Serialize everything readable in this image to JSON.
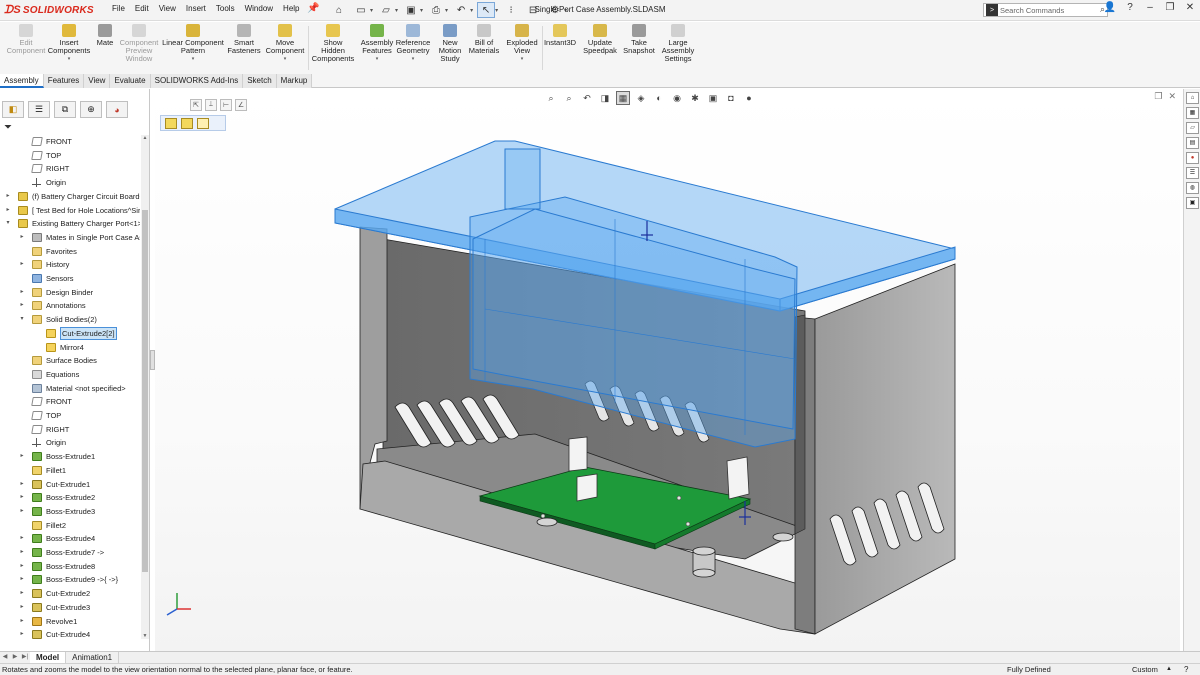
{
  "app": {
    "brand": "SOLIDWORKS",
    "doc_title": "Single Port Case Assembly.SLDASM",
    "menus": [
      "File",
      "Edit",
      "View",
      "Insert",
      "Tools",
      "Window",
      "Help"
    ],
    "search_placeholder": "Search Commands"
  },
  "commands": [
    {
      "label": "Edit Component",
      "disabled": true
    },
    {
      "label": "Insert Components",
      "disabled": false
    },
    {
      "label": "Mate",
      "disabled": false
    },
    {
      "label": "Component Preview Window",
      "disabled": true
    },
    {
      "label": "Linear Component Pattern",
      "disabled": false
    },
    {
      "label": "Smart Fasteners",
      "disabled": false
    },
    {
      "label": "Move Component",
      "disabled": false
    },
    {
      "label": "Show Hidden Components",
      "disabled": false
    },
    {
      "label": "Assembly Features",
      "disabled": false
    },
    {
      "label": "Reference Geometry",
      "disabled": false
    },
    {
      "label": "New Motion Study",
      "disabled": false
    },
    {
      "label": "Bill of Materials",
      "disabled": false
    },
    {
      "label": "Exploded View",
      "disabled": false
    },
    {
      "label": "Instant3D",
      "disabled": false
    },
    {
      "label": "Update Speedpak",
      "disabled": false
    },
    {
      "label": "Take Snapshot",
      "disabled": false
    },
    {
      "label": "Large Assembly Settings",
      "disabled": false
    }
  ],
  "tabs": [
    "Assembly",
    "Features",
    "View",
    "Evaluate",
    "SOLIDWORKS Add-Ins",
    "Sketch",
    "Markup"
  ],
  "tree": [
    {
      "label": "FRONT",
      "icon": "plane-icon",
      "indent": 1
    },
    {
      "label": "TOP",
      "icon": "plane-icon",
      "indent": 1
    },
    {
      "label": "RIGHT",
      "icon": "plane-icon",
      "indent": 1
    },
    {
      "label": "Origin",
      "icon": "origin-icon",
      "indent": 1
    },
    {
      "label": "(f) Battery Charger Circuit Board<",
      "icon": "part-icon",
      "indent": 0,
      "toggle": "▸"
    },
    {
      "label": "[ Test Bed for Hole Locations^Sir",
      "icon": "part-icon",
      "indent": 0,
      "toggle": "▸"
    },
    {
      "label": "Existing Battery Charger Port<1>",
      "icon": "part-icon",
      "indent": 0,
      "toggle": "▾"
    },
    {
      "label": "Mates in Single Port Case As",
      "icon": "mate-icon",
      "indent": 1,
      "toggle": "▸"
    },
    {
      "label": "Favorites",
      "icon": "folder-icon",
      "indent": 1
    },
    {
      "label": "History",
      "icon": "folder-icon",
      "indent": 1,
      "toggle": "▸"
    },
    {
      "label": "Sensors",
      "icon": "sensor-icon",
      "indent": 1
    },
    {
      "label": "Design Binder",
      "icon": "folder-icon",
      "indent": 1,
      "toggle": "▸"
    },
    {
      "label": "Annotations",
      "icon": "folder-icon",
      "indent": 1,
      "toggle": "▸"
    },
    {
      "label": "Solid Bodies(2)",
      "icon": "folder-icon",
      "indent": 1,
      "toggle": "▾"
    },
    {
      "label": "Cut-Extrude2[2]",
      "icon": "solid-icon",
      "indent": 2,
      "selected": true
    },
    {
      "label": "Mirror4",
      "icon": "solid-icon",
      "indent": 2
    },
    {
      "label": "Surface Bodies",
      "icon": "folder-icon",
      "indent": 1
    },
    {
      "label": "Equations",
      "icon": "eq-icon",
      "indent": 1
    },
    {
      "label": "Material <not specified>",
      "icon": "mat-icon",
      "indent": 1
    },
    {
      "label": "FRONT",
      "icon": "plane-icon",
      "indent": 1
    },
    {
      "label": "TOP",
      "icon": "plane-icon",
      "indent": 1
    },
    {
      "label": "RIGHT",
      "icon": "plane-icon",
      "indent": 1
    },
    {
      "label": "Origin",
      "icon": "origin-icon",
      "indent": 1
    },
    {
      "label": "Boss-Extrude1",
      "icon": "boss-icon",
      "indent": 1,
      "toggle": "▸"
    },
    {
      "label": "Fillet1",
      "icon": "fillet-icon",
      "indent": 1
    },
    {
      "label": "Cut-Extrude1",
      "icon": "cut-icon",
      "indent": 1,
      "toggle": "▸"
    },
    {
      "label": "Boss-Extrude2",
      "icon": "boss-icon",
      "indent": 1,
      "toggle": "▸"
    },
    {
      "label": "Boss-Extrude3",
      "icon": "boss-icon",
      "indent": 1,
      "toggle": "▸"
    },
    {
      "label": "Fillet2",
      "icon": "fillet-icon",
      "indent": 1
    },
    {
      "label": "Boss-Extrude4",
      "icon": "boss-icon",
      "indent": 1,
      "toggle": "▸"
    },
    {
      "label": "Boss-Extrude7 ->",
      "icon": "boss-icon",
      "indent": 1,
      "toggle": "▸"
    },
    {
      "label": "Boss-Extrude8",
      "icon": "boss-icon",
      "indent": 1,
      "toggle": "▸"
    },
    {
      "label": "Boss-Extrude9 ->{ ->}",
      "icon": "boss-icon",
      "indent": 1,
      "toggle": "▸"
    },
    {
      "label": "Cut-Extrude2",
      "icon": "cut-icon",
      "indent": 1,
      "toggle": "▸"
    },
    {
      "label": "Cut-Extrude3",
      "icon": "cut-icon",
      "indent": 1,
      "toggle": "▸"
    },
    {
      "label": "Revolve1",
      "icon": "revolve-icon",
      "indent": 1,
      "toggle": "▸"
    },
    {
      "label": "Cut-Extrude4",
      "icon": "cut-icon",
      "indent": 1,
      "toggle": "▸"
    }
  ],
  "bottom_tabs": [
    "Model",
    "Animation1"
  ],
  "status": {
    "message": "Rotates and zooms the model to the view orientation normal to the selected plane, planar face, or feature.",
    "state": "Fully Defined",
    "units": "Custom"
  },
  "colors": {
    "brand": "#da291c",
    "selection": "#4a90d9",
    "transparent_lid": "#5aa8f0",
    "case_gray": "#6e6e6e",
    "pcb": "#1e9a3a"
  }
}
